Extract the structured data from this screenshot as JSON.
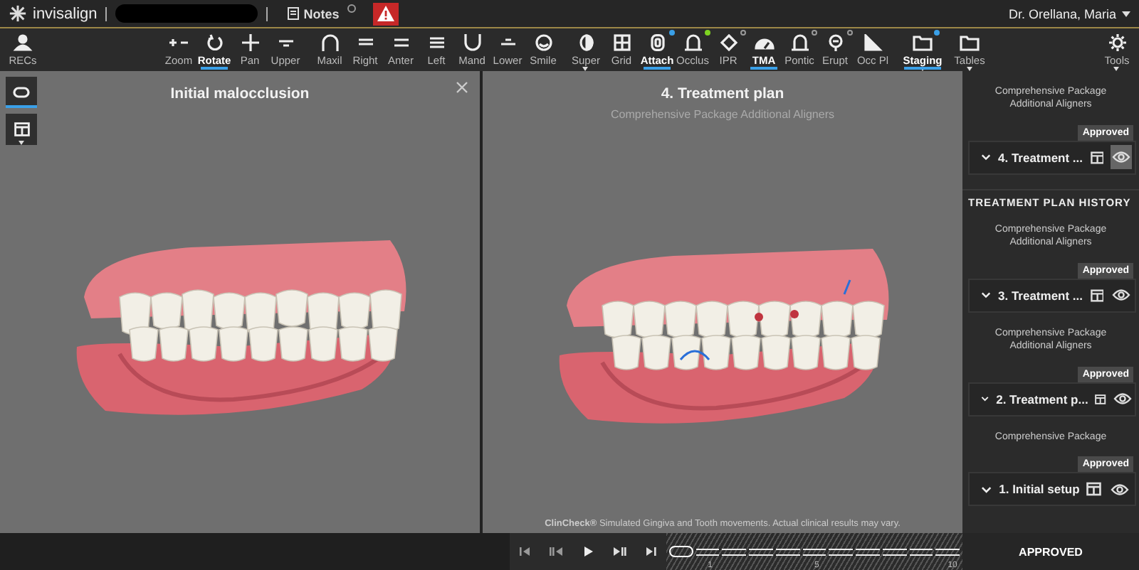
{
  "header": {
    "brand": "invisalign",
    "patient_name_redacted": true,
    "notes": "Notes",
    "user": "Dr. Orellana, Maria"
  },
  "toolbar": [
    {
      "label": "RECs",
      "selected": false,
      "dropdown": false
    },
    {
      "label": "Zoom",
      "selected": false,
      "dropdown": false
    },
    {
      "label": "Rotate",
      "selected": true,
      "dropdown": false
    },
    {
      "label": "Pan",
      "selected": false,
      "dropdown": false
    },
    {
      "label": "Upper",
      "selected": false,
      "dropdown": false
    },
    {
      "label": "Maxil",
      "selected": false,
      "dropdown": false
    },
    {
      "label": "Right",
      "selected": false,
      "dropdown": false
    },
    {
      "label": "Anter",
      "selected": false,
      "dropdown": false
    },
    {
      "label": "Left",
      "selected": false,
      "dropdown": false
    },
    {
      "label": "Mand",
      "selected": false,
      "dropdown": false
    },
    {
      "label": "Lower",
      "selected": false,
      "dropdown": false
    },
    {
      "label": "Smile",
      "selected": false,
      "dropdown": false
    },
    {
      "label": "Super",
      "selected": false,
      "dropdown": true
    },
    {
      "label": "Grid",
      "selected": false,
      "dropdown": false
    },
    {
      "label": "Attach",
      "selected": true,
      "dropdown": false,
      "badge": {
        "kind": "filled",
        "color": "#3aa0e8"
      }
    },
    {
      "label": "Occlus",
      "selected": false,
      "dropdown": false,
      "badge": {
        "kind": "filled",
        "color": "#7ed321"
      }
    },
    {
      "label": "IPR",
      "selected": false,
      "dropdown": false,
      "badge": {
        "kind": "ring",
        "color": "#9a9a9a"
      }
    },
    {
      "label": "TMA",
      "selected": true,
      "dropdown": false
    },
    {
      "label": "Pontic",
      "selected": false,
      "dropdown": false,
      "badge": {
        "kind": "ring",
        "color": "#9a9a9a"
      }
    },
    {
      "label": "Erupt",
      "selected": false,
      "dropdown": false,
      "badge": {
        "kind": "ring",
        "color": "#9a9a9a"
      }
    },
    {
      "label": "Occ Pl",
      "selected": false,
      "dropdown": false
    },
    {
      "label": "Staging",
      "selected": true,
      "dropdown": true,
      "badge": {
        "kind": "filled",
        "color": "#3aa0e8"
      }
    },
    {
      "label": "Tables",
      "selected": false,
      "dropdown": true
    },
    {
      "label": "Tools",
      "selected": false,
      "dropdown": true
    }
  ],
  "side_tools": [
    {
      "selected": true,
      "dropdown": false
    },
    {
      "selected": false,
      "dropdown": true
    }
  ],
  "viewers": [
    {
      "title": "Initial malocclusion",
      "closable": true,
      "kind": "initial"
    },
    {
      "title": "4. Treatment plan",
      "subtitle": "Comprehensive Package Additional Aligners",
      "closable": false,
      "kind": "treated",
      "disclaimer": "**ClinCheck®** Simulated Gingiva and Tooth movements. Actual clinical results may vary."
    }
  ],
  "playback": {
    "stages": [
      {
        "selected": true
      },
      {
        "selected": false,
        "label": "1"
      },
      {
        "selected": false
      },
      {
        "selected": false
      },
      {
        "selected": false
      },
      {
        "selected": false,
        "label": "5"
      },
      {
        "selected": false
      },
      {
        "selected": false
      },
      {
        "selected": false
      },
      {
        "selected": false
      },
      {
        "selected": false,
        "label": "10"
      }
    ]
  },
  "current_plan": {
    "package": "Comprehensive Package Additional Aligners",
    "status": "Approved",
    "name": "4. Treatment ...",
    "viewing": true
  },
  "history_title": "TREATMENT PLAN HISTORY",
  "history": [
    {
      "package": "Comprehensive Package Additional Aligners",
      "status": "Approved",
      "name": "3. Treatment ...",
      "viewing": false
    },
    {
      "package": "Comprehensive Package Additional Aligners",
      "status": "Approved",
      "name": "2. Treatment p...",
      "viewing": false
    },
    {
      "package": "Comprehensive Package",
      "status": "Approved",
      "name": "1. Initial setup",
      "viewing": false
    }
  ],
  "footer_status": "APPROVED"
}
